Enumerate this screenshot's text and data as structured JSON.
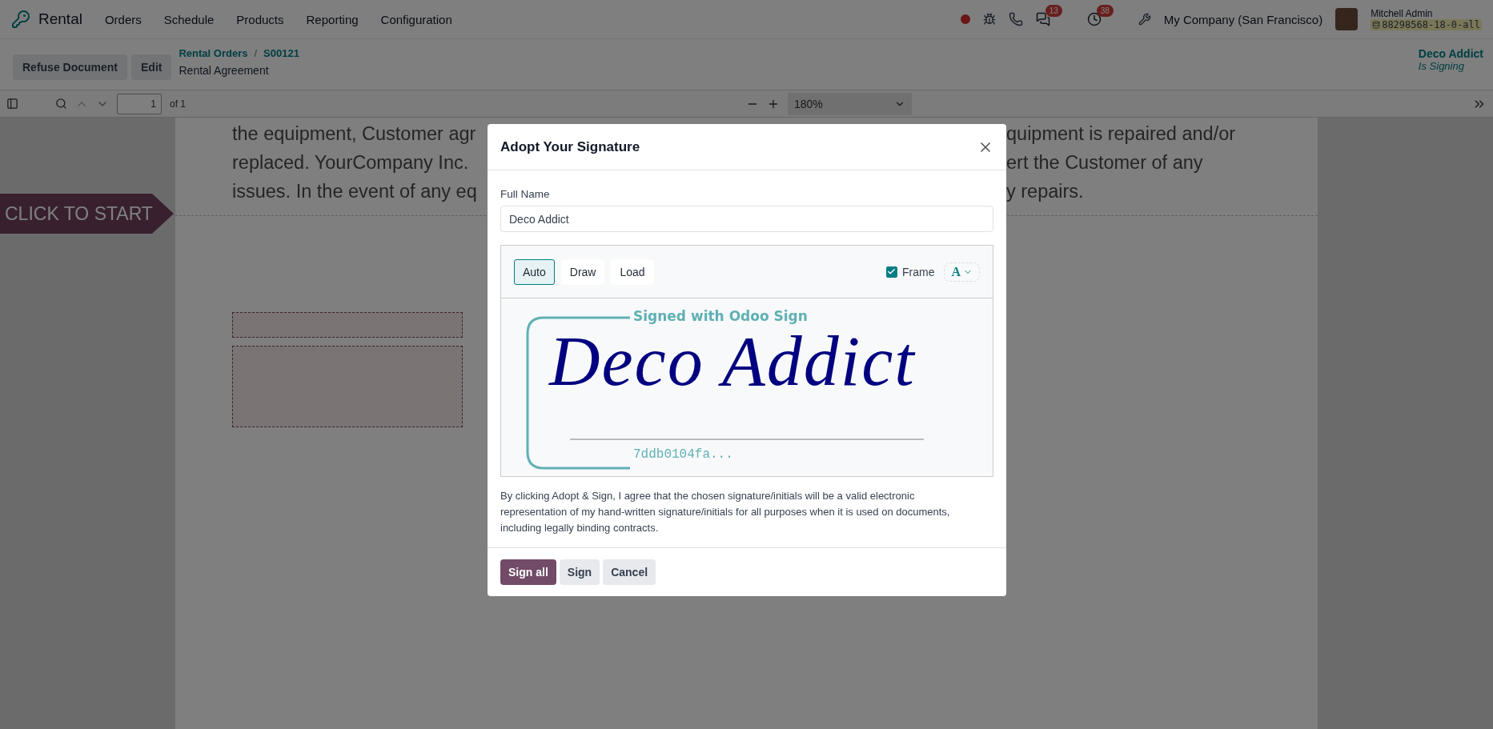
{
  "navbar": {
    "app": "Rental",
    "menu": [
      "Orders",
      "Schedule",
      "Products",
      "Reporting",
      "Configuration"
    ],
    "systray": {
      "recording": true,
      "messages_badge": "13",
      "activities_badge": "38",
      "company": "My Company (San Francisco)",
      "user": "Mitchell Admin",
      "database": "88298568-18-0-all"
    }
  },
  "control_panel": {
    "buttons": [
      "Refuse Document",
      "Edit"
    ],
    "breadcrumbs": [
      "Rental Orders",
      "S00121"
    ],
    "breadcrumb_separator": "/",
    "title": "Rental Agreement",
    "signer": {
      "name": "Deco Addict",
      "status": "Is Signing"
    }
  },
  "pdf_toolbar": {
    "page": "1",
    "page_count": "of 1",
    "zoom": "180%"
  },
  "document": {
    "start_tag": "CLICK TO START",
    "lines": [
      {
        "left": "the equipment, Customer agr",
        "right": "quipment is repaired and/or"
      },
      {
        "left": "replaced. YourCompany Inc.",
        "right": "ert the Customer of any"
      },
      {
        "left": "issues. In the event of any eq",
        "right": "y repairs."
      }
    ],
    "sign_fields": [
      {
        "kind": "name"
      },
      {
        "kind": "signature"
      }
    ]
  },
  "dialog": {
    "title": "Adopt Your Signature",
    "full_name_label": "Full Name",
    "full_name": "Deco Addict",
    "modes": [
      {
        "label": "Auto",
        "selected": true
      },
      {
        "label": "Draw",
        "selected": false
      },
      {
        "label": "Load",
        "selected": false
      }
    ],
    "frame": {
      "label": "Frame",
      "checked": true
    },
    "font_button": "A",
    "signature": "Deco Addict",
    "frame_caption": "Signed with Odoo Sign",
    "frame_hash": "7ddb0104fa...",
    "legal_text": "By clicking Adopt & Sign, I agree that the chosen signature/initials will be a valid electronic representation of my hand-written signature/initials for all purposes when it is used on documents, including legally binding contracts.",
    "buttons": [
      {
        "label": "Sign all",
        "kind": "primary"
      },
      {
        "label": "Sign",
        "kind": "secondary"
      },
      {
        "label": "Cancel",
        "kind": "secondary"
      }
    ]
  }
}
